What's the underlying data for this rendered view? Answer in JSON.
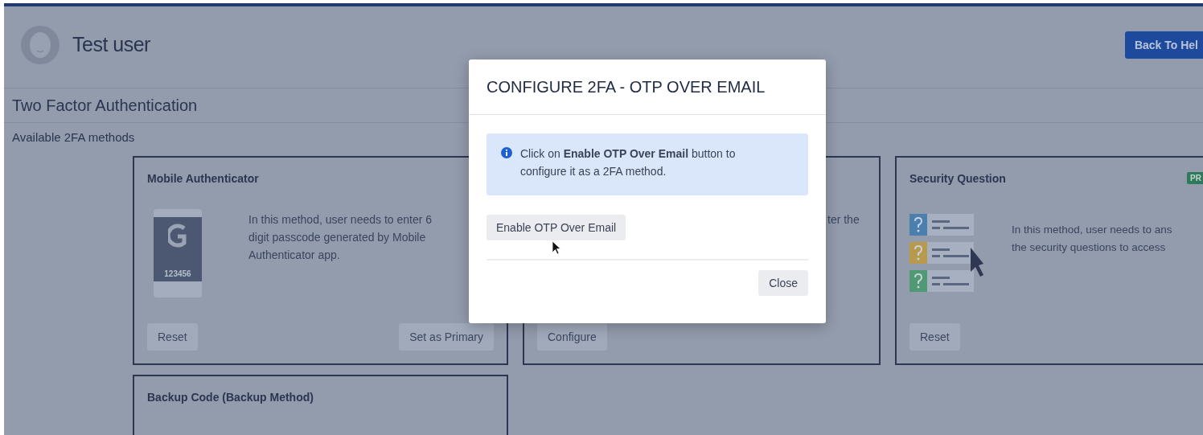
{
  "header": {
    "user_name": "Test user",
    "back_button": "Back To Hel"
  },
  "page_title": "Two Factor Authentication",
  "section_label": "Available 2FA methods",
  "methods": [
    {
      "kind": "mobile",
      "title": "Mobile Authenticator",
      "passcode": "123456",
      "description_lines": [
        "In this method, user needs to enter 6",
        "digit passcode generated by Mobile",
        "Authenticator app."
      ],
      "buttons": [
        "Reset",
        "Set as Primary"
      ]
    },
    {
      "kind": "covered",
      "description_lines": [
        "ter the"
      ],
      "buttons": [
        "Configure"
      ]
    },
    {
      "kind": "security",
      "title": "Security Question",
      "badge": "PR",
      "description_lines": [
        "In this method, user needs to ans",
        "the security questions to access"
      ],
      "buttons": [
        "Reset"
      ]
    },
    {
      "kind": "backup",
      "title": "Backup Code (Backup Method)"
    }
  ],
  "modal": {
    "title": "CONFIGURE 2FA - OTP OVER EMAIL",
    "info": "Click on **Enable OTP Over Email** button to configure it as a 2FA method.",
    "action_button": "Enable OTP Over Email",
    "close_button": "Close"
  }
}
